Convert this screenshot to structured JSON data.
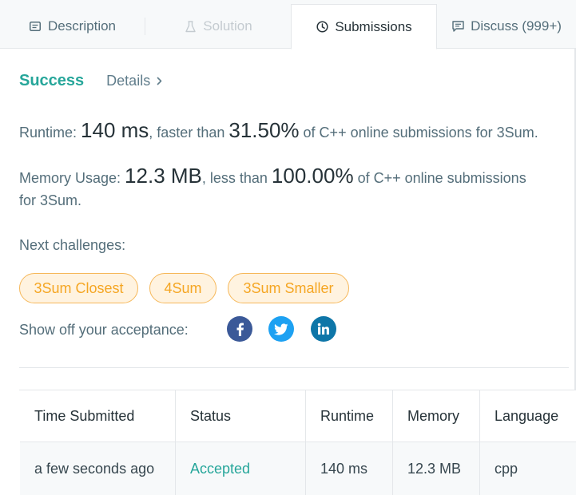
{
  "tabs": [
    {
      "label": "Description",
      "icon": "description-icon",
      "state": "normal"
    },
    {
      "label": "Solution",
      "icon": "flask-icon",
      "state": "disabled"
    },
    {
      "label": "Submissions",
      "icon": "clock-icon",
      "state": "active"
    },
    {
      "label": "Discuss (999+)",
      "icon": "discuss-icon",
      "state": "normal"
    }
  ],
  "result": {
    "status": "Success",
    "details_label": "Details"
  },
  "runtime": {
    "label": "Runtime: ",
    "value": "140 ms",
    "mid": ", faster than ",
    "percent": "31.50%",
    "tail": " of C++ online submissions for 3Sum."
  },
  "memory": {
    "label": "Memory Usage: ",
    "value": "12.3 MB",
    "mid": ", less than ",
    "percent": "100.00%",
    "tail": " of C++ online submissions",
    "tail2": "for 3Sum."
  },
  "next": {
    "label": "Next challenges:",
    "items": [
      "3Sum Closest",
      "4Sum",
      "3Sum Smaller"
    ]
  },
  "share": {
    "label": "Show off your acceptance:",
    "networks": [
      "facebook-icon",
      "twitter-icon",
      "linkedin-icon"
    ]
  },
  "table": {
    "headers": [
      "Time Submitted",
      "Status",
      "Runtime",
      "Memory",
      "Language"
    ],
    "rows": [
      [
        "a few seconds ago",
        "Accepted",
        "140 ms",
        "12.3 MB",
        "cpp"
      ]
    ]
  },
  "colors": {
    "success": "#26a69a",
    "chip_border": "#f6b85a",
    "chip_text": "#f5a623",
    "facebook": "#3b5998",
    "twitter": "#1da1f2",
    "linkedin": "#0e76a8"
  }
}
